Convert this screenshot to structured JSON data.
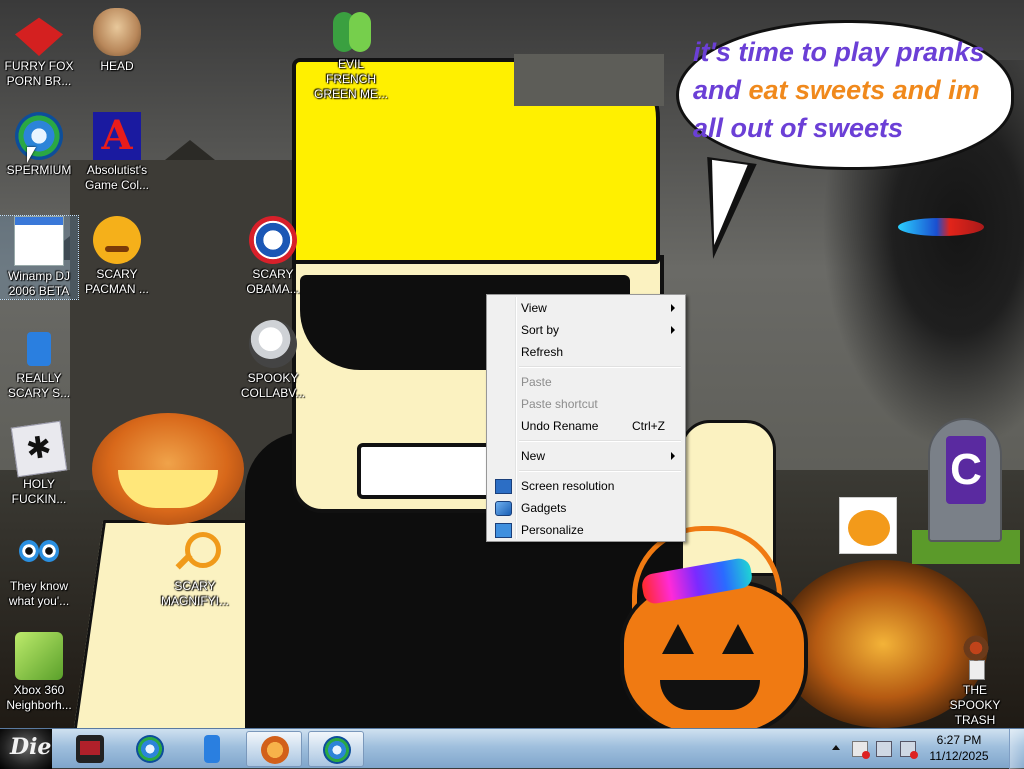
{
  "wallpaper": {
    "speech_bubble": {
      "line1": "it's time to play pranks",
      "line2_a": "and ",
      "line2_b": "eat sweets and im",
      "line3": "all out of sweets"
    },
    "colors": {
      "bubble_text": "#6b3fd6",
      "bubble_accent": "#f0891c",
      "hat": "#fff000"
    }
  },
  "desktop_icons": [
    {
      "label": "FURRY FOX\nPORN BR...",
      "icon": "fox-icon"
    },
    {
      "label": "HEAD",
      "icon": "head-icon"
    },
    {
      "label": "EVIL FRENCH\nGREEN ME...",
      "icon": "messenger-icon"
    },
    {
      "label": "SPERMIUM",
      "icon": "browser-icon"
    },
    {
      "label": "Absolutist's\nGame Col...",
      "icon": "absolutist-icon"
    },
    {
      "label": "Winamp DJ\n2006 BETA",
      "icon": "winamp-icon"
    },
    {
      "label": "SCARY\nPACMAN ...",
      "icon": "pacman-icon"
    },
    {
      "label": "SCARY\nOBAMA...",
      "icon": "obama-icon"
    },
    {
      "label": "REALLY\nSCARY S...",
      "icon": "xat-icon"
    },
    {
      "label": "SPOOKY\nCOLLABV...",
      "icon": "skull-icon"
    },
    {
      "label": "HOLY\nFUCKIN...",
      "icon": "spider-icon"
    },
    {
      "label": "They know\nwhat you'...",
      "icon": "eyes-icon"
    },
    {
      "label": "SCARY\nMAGNIFYI...",
      "icon": "magnifier-icon"
    },
    {
      "label": "Xbox 360\nNeighborh...",
      "icon": "xbox-icon"
    },
    {
      "label": "THE SPOOKY\nTRASH",
      "icon": "recycle-bin-icon"
    }
  ],
  "context_menu": {
    "view": "View",
    "sort_by": "Sort by",
    "refresh": "Refresh",
    "paste": "Paste",
    "paste_shortcut": "Paste shortcut",
    "undo_rename": "Undo Rename",
    "undo_rename_shortcut": "Ctrl+Z",
    "new": "New",
    "screen_resolution": "Screen resolution",
    "gadgets": "Gadgets",
    "personalize": "Personalize"
  },
  "taskbar": {
    "start_label": "Die",
    "clock_time": "6:27 PM",
    "clock_date": "11/12/2025",
    "buttons": [
      "explorer-icon",
      "browser-icon",
      "xat-icon",
      "pumpkin-icon",
      "browser-icon"
    ]
  }
}
